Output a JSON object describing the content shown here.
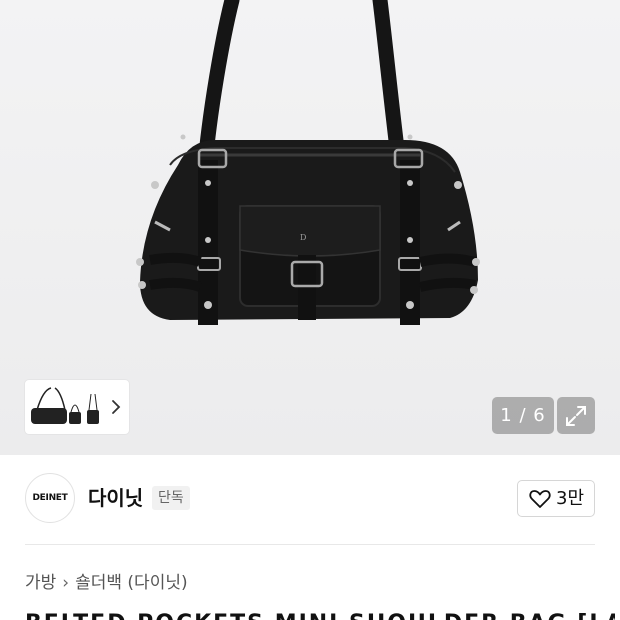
{
  "gallery": {
    "counter": "1 / 6",
    "icons": {
      "expand": "expand-icon",
      "next": "chevron-right-icon"
    }
  },
  "brand": {
    "logo_text": "DEINET",
    "name": "다이닛",
    "badge": "단독"
  },
  "like": {
    "icon": "heart-icon",
    "count": "3만"
  },
  "breadcrumb": {
    "items": [
      "가방",
      "숄더백 (다이닛)"
    ]
  },
  "product": {
    "title": "BELTED POCKETS MINI SHOULDER BAG [LAB"
  },
  "colors": {
    "accent_overlay": "#8a8a8a",
    "text": "#111111"
  }
}
